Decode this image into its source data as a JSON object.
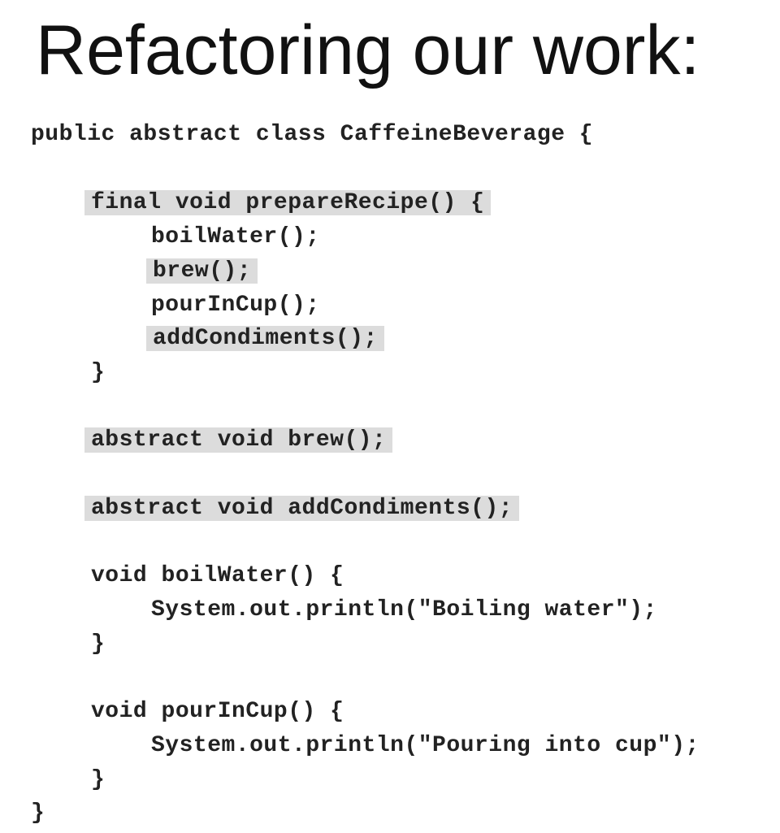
{
  "slide": {
    "title": "Refactoring our work:"
  },
  "code": {
    "class_decl": "public abstract class CaffeineBeverage {",
    "prepare_recipe_decl": "final void prepareRecipe() {",
    "call_boil_water": "boilWater();",
    "call_brew": "brew();",
    "call_pour_in_cup": "pourInCup();",
    "call_add_condiments": "addCondiments();",
    "close_prepare_recipe": "}",
    "abstract_brew": "abstract void brew();",
    "abstract_add_condiments": "abstract void addCondiments();",
    "boil_water_decl": "void boilWater() {",
    "boil_water_body": "System.out.println(\"Boiling water\");",
    "close_boil_water": "}",
    "pour_in_cup_decl": "void pourInCup() {",
    "pour_in_cup_body": "System.out.println(\"Pouring into cup\");",
    "close_pour_in_cup": "}",
    "close_class": "}"
  },
  "colors": {
    "highlight": "#dcdcdc",
    "text": "#222222",
    "title": "#111111"
  }
}
